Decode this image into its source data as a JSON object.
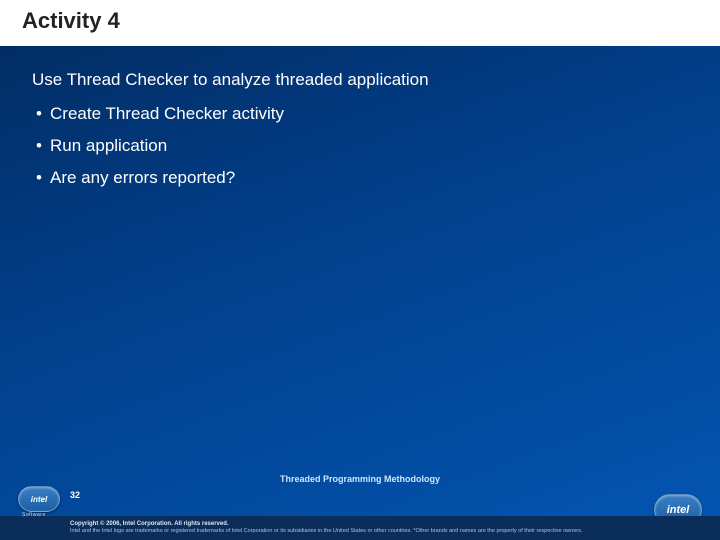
{
  "title": "Activity 4",
  "lead": "Use Thread Checker to analyze threaded application",
  "bullets": [
    "Create Thread Checker activity",
    "Run application",
    "Are any errors reported?"
  ],
  "footer_topic": "Threaded Programming Methodology",
  "slide_number": "32",
  "copyright": "Copyright © 2006, Intel Corporation. All rights reserved.",
  "trademark": "Intel and the Intel logo are trademarks or registered trademarks of Intel Corporation or its subsidiaries in the United States or other countries. *Other brands and names are the property of their respective owners.",
  "logo_text": "intel",
  "software_label": "Software"
}
